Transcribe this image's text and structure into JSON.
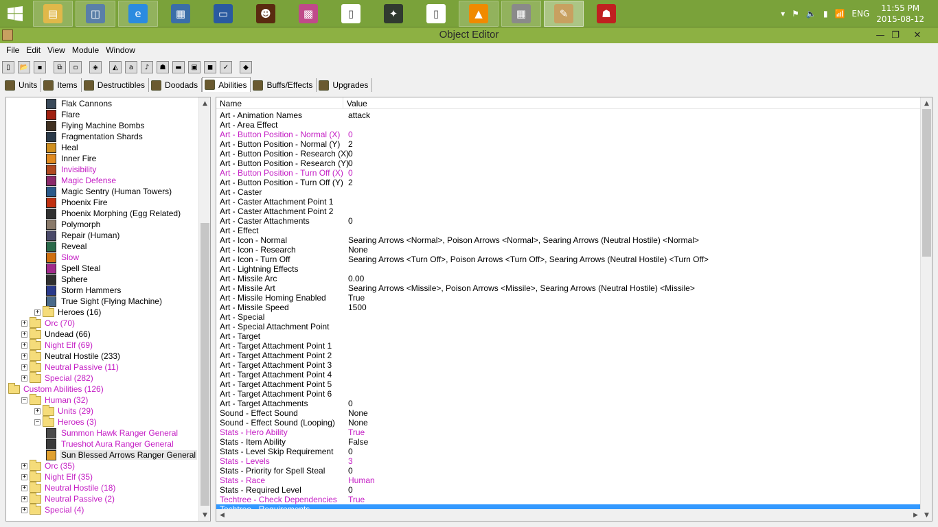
{
  "taskbar": {
    "apps": [
      {
        "name": "file-explorer",
        "color": "#e0b84a",
        "glyph": "▤",
        "state": "open"
      },
      {
        "name": "performance-monitor",
        "color": "#5a7fa8",
        "glyph": "◫",
        "state": "open"
      },
      {
        "name": "internet-explorer",
        "color": "#2b8be0",
        "glyph": "e",
        "state": "open"
      },
      {
        "name": "control-panel",
        "color": "#3b6ea8",
        "glyph": "▦",
        "state": "none"
      },
      {
        "name": "window-app",
        "color": "#2a5aa0",
        "glyph": "▭",
        "state": "none"
      },
      {
        "name": "game-hero-app",
        "color": "#5a2a10",
        "glyph": "☻",
        "state": "none"
      },
      {
        "name": "palette-app",
        "color": "#c04a8a",
        "glyph": "▩",
        "state": "none"
      },
      {
        "name": "blank-window-app",
        "color": "#ffffff",
        "glyph": "▯",
        "state": "none"
      },
      {
        "name": "emblem-app",
        "color": "#303a30",
        "glyph": "✦",
        "state": "none"
      },
      {
        "name": "document-app",
        "color": "#ffffff",
        "glyph": "▯",
        "state": "none"
      },
      {
        "name": "vlc-player",
        "color": "#f08a00",
        "glyph": "▲",
        "state": "open"
      },
      {
        "name": "terrain-editor",
        "color": "#8a8a8a",
        "glyph": "▦",
        "state": "open"
      },
      {
        "name": "object-editor",
        "color": "#c8a060",
        "glyph": "✎",
        "state": "active"
      },
      {
        "name": "red-character-app",
        "color": "#c02020",
        "glyph": "☗",
        "state": "none"
      }
    ],
    "language": "ENG",
    "time": "11:55 PM",
    "date": "2015-08-12"
  },
  "window": {
    "title": "Object Editor",
    "minimize": "—",
    "restore": "❐",
    "close": "✕"
  },
  "menu": [
    "File",
    "Edit",
    "View",
    "Module",
    "Window"
  ],
  "toolbar": [
    {
      "name": "new-icon",
      "glyph": "▯"
    },
    {
      "name": "open-icon",
      "glyph": "📂"
    },
    {
      "name": "save-icon",
      "glyph": "▪"
    },
    {
      "name": "copy-icon",
      "glyph": "⧉"
    },
    {
      "name": "paste-icon",
      "glyph": "▫"
    },
    {
      "name": "terrain-editor-icon",
      "glyph": "◈"
    },
    {
      "name": "trigger-editor-icon",
      "glyph": "◭"
    },
    {
      "name": "sound-editor-icon",
      "glyph": "a"
    },
    {
      "name": "speaker-icon",
      "glyph": "♪"
    },
    {
      "name": "object-editor-icon",
      "glyph": "☗"
    },
    {
      "name": "campaign-editor-icon",
      "glyph": "▬"
    },
    {
      "name": "ai-editor-icon",
      "glyph": "▣"
    },
    {
      "name": "import-manager-icon",
      "glyph": "◼"
    },
    {
      "name": "object-manager-icon",
      "glyph": "✓"
    },
    {
      "name": "test-map-icon",
      "glyph": "◆"
    }
  ],
  "tabs": [
    {
      "label": "Units",
      "selected": false
    },
    {
      "label": "Items",
      "selected": false
    },
    {
      "label": "Destructibles",
      "selected": false
    },
    {
      "label": "Doodads",
      "selected": false
    },
    {
      "label": "Abilities",
      "selected": true
    },
    {
      "label": "Buffs/Effects",
      "selected": false
    },
    {
      "label": "Upgrades",
      "selected": false
    }
  ],
  "tree": [
    {
      "label": "Flak Cannons",
      "level": 3,
      "type": "ability",
      "color": "#3a4a5a",
      "modified": false
    },
    {
      "label": "Flare",
      "level": 3,
      "type": "ability",
      "color": "#a02010",
      "modified": false
    },
    {
      "label": "Flying Machine Bombs",
      "level": 3,
      "type": "ability",
      "color": "#403020",
      "modified": false
    },
    {
      "label": "Fragmentation Shards",
      "level": 3,
      "type": "ability",
      "color": "#2a3a4a",
      "modified": false
    },
    {
      "label": "Heal",
      "level": 3,
      "type": "ability",
      "color": "#d09020",
      "modified": false
    },
    {
      "label": "Inner Fire",
      "level": 3,
      "type": "ability",
      "color": "#e08a20",
      "modified": false
    },
    {
      "label": "Invisibility",
      "level": 3,
      "type": "ability",
      "color": "#b04a20",
      "modified": true
    },
    {
      "label": "Magic Defense",
      "level": 3,
      "type": "ability",
      "color": "#8a2a6a",
      "modified": true
    },
    {
      "label": "Magic Sentry (Human Towers)",
      "level": 3,
      "type": "ability",
      "color": "#2a5a8a",
      "modified": false
    },
    {
      "label": "Phoenix Fire",
      "level": 3,
      "type": "ability",
      "color": "#c03010",
      "modified": false
    },
    {
      "label": "Phoenix Morphing (Egg Related)",
      "level": 3,
      "type": "ability",
      "color": "#303030",
      "modified": false
    },
    {
      "label": "Polymorph",
      "level": 3,
      "type": "ability",
      "color": "#8a7a6a",
      "modified": false
    },
    {
      "label": "Repair (Human)",
      "level": 3,
      "type": "ability",
      "color": "#4a4a6a",
      "modified": false
    },
    {
      "label": "Reveal",
      "level": 3,
      "type": "ability",
      "color": "#2a6a4a",
      "modified": false
    },
    {
      "label": "Slow",
      "level": 3,
      "type": "ability",
      "color": "#d07010",
      "modified": true
    },
    {
      "label": "Spell Steal",
      "level": 3,
      "type": "ability",
      "color": "#a02a8a",
      "modified": false
    },
    {
      "label": "Sphere",
      "level": 3,
      "type": "ability",
      "color": "#303030",
      "modified": false
    },
    {
      "label": "Storm Hammers",
      "level": 3,
      "type": "ability",
      "color": "#2a3a8a",
      "modified": false
    },
    {
      "label": "True Sight (Flying Machine)",
      "level": 3,
      "type": "ability",
      "color": "#4a6a8a",
      "modified": false
    },
    {
      "label": "Heroes (16)",
      "level": 2,
      "type": "folder",
      "expander": "+",
      "modified": false
    },
    {
      "label": "Orc (70)",
      "level": 1,
      "type": "folder",
      "expander": "+",
      "modified": true
    },
    {
      "label": "Undead (66)",
      "level": 1,
      "type": "folder",
      "expander": "+",
      "modified": false
    },
    {
      "label": "Night Elf (69)",
      "level": 1,
      "type": "folder",
      "expander": "+",
      "modified": true
    },
    {
      "label": "Neutral Hostile (233)",
      "level": 1,
      "type": "folder",
      "expander": "+",
      "modified": false
    },
    {
      "label": "Neutral Passive (11)",
      "level": 1,
      "type": "folder",
      "expander": "+",
      "modified": true
    },
    {
      "label": "Special (282)",
      "level": 1,
      "type": "folder",
      "expander": "+",
      "modified": true
    },
    {
      "label": "Custom Abilities (126)",
      "level": 0,
      "type": "folder",
      "expander": "",
      "modified": true
    },
    {
      "label": "Human (32)",
      "level": 1,
      "type": "folder",
      "expander": "−",
      "modified": true
    },
    {
      "label": "Units (29)",
      "level": 2,
      "type": "folder",
      "expander": "+",
      "modified": true
    },
    {
      "label": "Heroes (3)",
      "level": 2,
      "type": "folder",
      "expander": "−",
      "modified": true
    },
    {
      "label": "Summon Hawk Ranger General",
      "level": 3,
      "type": "ability",
      "color": "#4a4a4a",
      "modified": true
    },
    {
      "label": "Trueshot Aura Ranger General",
      "level": 3,
      "type": "ability",
      "color": "#3a3a3a",
      "modified": true
    },
    {
      "label": "Sun Blessed Arrows Ranger General",
      "level": 3,
      "type": "ability",
      "color": "#e0a030",
      "modified": false,
      "selected": true
    },
    {
      "label": "Orc (35)",
      "level": 1,
      "type": "folder",
      "expander": "+",
      "modified": true
    },
    {
      "label": "Night Elf (35)",
      "level": 1,
      "type": "folder",
      "expander": "+",
      "modified": true
    },
    {
      "label": "Neutral Hostile (18)",
      "level": 1,
      "type": "folder",
      "expander": "+",
      "modified": true
    },
    {
      "label": "Neutral Passive (2)",
      "level": 1,
      "type": "folder",
      "expander": "+",
      "modified": true
    },
    {
      "label": "Special (4)",
      "level": 1,
      "type": "folder",
      "expander": "+",
      "modified": true
    }
  ],
  "grid": {
    "columns": [
      "Name",
      "Value"
    ],
    "rows": [
      {
        "name": "Art - Animation Names",
        "value": "attack",
        "modified": false
      },
      {
        "name": "Art - Area Effect",
        "value": "",
        "modified": false
      },
      {
        "name": "Art - Button Position - Normal (X)",
        "value": "0",
        "modified": true
      },
      {
        "name": "Art - Button Position - Normal (Y)",
        "value": "2",
        "modified": false
      },
      {
        "name": "Art - Button Position - Research (X)",
        "value": "0",
        "modified": false
      },
      {
        "name": "Art - Button Position - Research (Y)",
        "value": "0",
        "modified": false
      },
      {
        "name": "Art - Button Position - Turn Off (X)",
        "value": "0",
        "modified": true
      },
      {
        "name": "Art - Button Position - Turn Off (Y)",
        "value": "2",
        "modified": false
      },
      {
        "name": "Art - Caster",
        "value": "",
        "modified": false
      },
      {
        "name": "Art - Caster Attachment Point 1",
        "value": "",
        "modified": false
      },
      {
        "name": "Art - Caster Attachment Point 2",
        "value": "",
        "modified": false
      },
      {
        "name": "Art - Caster Attachments",
        "value": "0",
        "modified": false
      },
      {
        "name": "Art - Effect",
        "value": "",
        "modified": false
      },
      {
        "name": "Art - Icon - Normal",
        "value": "Searing Arrows <Normal>, Poison Arrows <Normal>, Searing Arrows (Neutral Hostile) <Normal>",
        "modified": false
      },
      {
        "name": "Art - Icon - Research",
        "value": "None",
        "modified": false
      },
      {
        "name": "Art - Icon - Turn Off",
        "value": "Searing Arrows <Turn Off>, Poison Arrows <Turn Off>, Searing Arrows (Neutral Hostile) <Turn Off>",
        "modified": false
      },
      {
        "name": "Art - Lightning Effects",
        "value": "",
        "modified": false
      },
      {
        "name": "Art - Missile Arc",
        "value": "0.00",
        "modified": false
      },
      {
        "name": "Art - Missile Art",
        "value": "Searing Arrows <Missile>, Poison Arrows <Missile>, Searing Arrows (Neutral Hostile) <Missile>",
        "modified": false
      },
      {
        "name": "Art - Missile Homing Enabled",
        "value": "True",
        "modified": false
      },
      {
        "name": "Art - Missile Speed",
        "value": "1500",
        "modified": false
      },
      {
        "name": "Art - Special",
        "value": "",
        "modified": false
      },
      {
        "name": "Art - Special Attachment Point",
        "value": "",
        "modified": false
      },
      {
        "name": "Art - Target",
        "value": "",
        "modified": false
      },
      {
        "name": "Art - Target Attachment Point 1",
        "value": "",
        "modified": false
      },
      {
        "name": "Art - Target Attachment Point 2",
        "value": "",
        "modified": false
      },
      {
        "name": "Art - Target Attachment Point 3",
        "value": "",
        "modified": false
      },
      {
        "name": "Art - Target Attachment Point 4",
        "value": "",
        "modified": false
      },
      {
        "name": "Art - Target Attachment Point 5",
        "value": "",
        "modified": false
      },
      {
        "name": "Art - Target Attachment Point 6",
        "value": "",
        "modified": false
      },
      {
        "name": "Art - Target Attachments",
        "value": "0",
        "modified": false
      },
      {
        "name": "Sound - Effect Sound",
        "value": "None",
        "modified": false
      },
      {
        "name": "Sound - Effect Sound (Looping)",
        "value": "None",
        "modified": false
      },
      {
        "name": "Stats - Hero Ability",
        "value": "True",
        "modified": true
      },
      {
        "name": "Stats - Item Ability",
        "value": "False",
        "modified": false
      },
      {
        "name": "Stats - Level Skip Requirement",
        "value": "0",
        "modified": false
      },
      {
        "name": "Stats - Levels",
        "value": "3",
        "modified": true
      },
      {
        "name": "Stats - Priority for Spell Steal",
        "value": "0",
        "modified": false
      },
      {
        "name": "Stats - Race",
        "value": "Human",
        "modified": true
      },
      {
        "name": "Stats - Required Level",
        "value": "0",
        "modified": false
      },
      {
        "name": "Techtree - Check Dependencies",
        "value": "True",
        "modified": true
      },
      {
        "name": "Techtree - Requirements",
        "value": "",
        "modified": true,
        "selected": true
      }
    ]
  },
  "colors": {
    "taskbar": "#7aa23a",
    "titlebar": "#8db143",
    "modified_text": "#c41cc4",
    "selection": "#3399ff"
  }
}
